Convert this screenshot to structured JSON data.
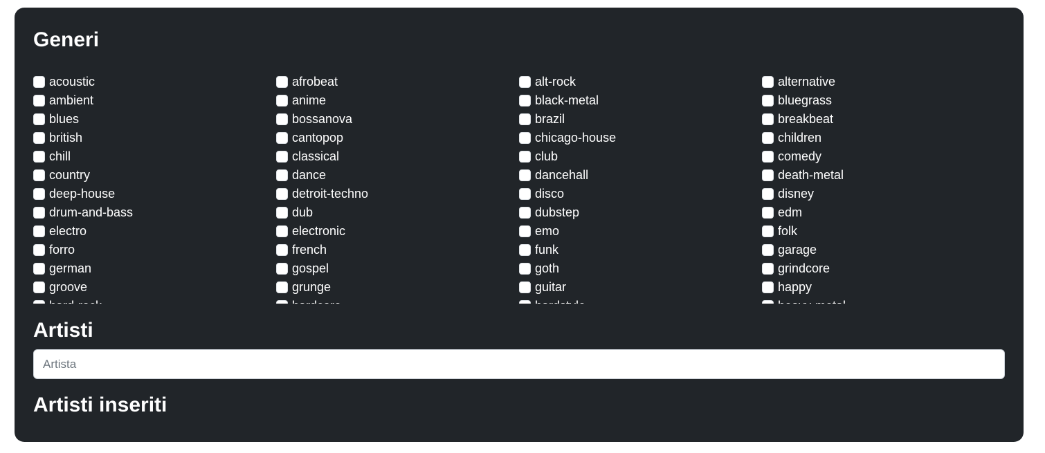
{
  "sections": {
    "genres_title": "Generi",
    "artists_title": "Artisti",
    "inserted_artists_title": "Artisti inseriti"
  },
  "artist_input": {
    "placeholder": "Artista",
    "value": ""
  },
  "genres": [
    {
      "label": "acoustic",
      "checked": false
    },
    {
      "label": "afrobeat",
      "checked": false
    },
    {
      "label": "alt-rock",
      "checked": false
    },
    {
      "label": "alternative",
      "checked": false
    },
    {
      "label": "ambient",
      "checked": false
    },
    {
      "label": "anime",
      "checked": false
    },
    {
      "label": "black-metal",
      "checked": false
    },
    {
      "label": "bluegrass",
      "checked": false
    },
    {
      "label": "blues",
      "checked": false
    },
    {
      "label": "bossanova",
      "checked": false
    },
    {
      "label": "brazil",
      "checked": false
    },
    {
      "label": "breakbeat",
      "checked": false
    },
    {
      "label": "british",
      "checked": false
    },
    {
      "label": "cantopop",
      "checked": false
    },
    {
      "label": "chicago-house",
      "checked": false
    },
    {
      "label": "children",
      "checked": false
    },
    {
      "label": "chill",
      "checked": false
    },
    {
      "label": "classical",
      "checked": false
    },
    {
      "label": "club",
      "checked": false
    },
    {
      "label": "comedy",
      "checked": false
    },
    {
      "label": "country",
      "checked": false
    },
    {
      "label": "dance",
      "checked": false
    },
    {
      "label": "dancehall",
      "checked": false
    },
    {
      "label": "death-metal",
      "checked": false
    },
    {
      "label": "deep-house",
      "checked": false
    },
    {
      "label": "detroit-techno",
      "checked": false
    },
    {
      "label": "disco",
      "checked": false
    },
    {
      "label": "disney",
      "checked": false
    },
    {
      "label": "drum-and-bass",
      "checked": false
    },
    {
      "label": "dub",
      "checked": false
    },
    {
      "label": "dubstep",
      "checked": false
    },
    {
      "label": "edm",
      "checked": false
    },
    {
      "label": "electro",
      "checked": false
    },
    {
      "label": "electronic",
      "checked": false
    },
    {
      "label": "emo",
      "checked": false
    },
    {
      "label": "folk",
      "checked": false
    },
    {
      "label": "forro",
      "checked": false
    },
    {
      "label": "french",
      "checked": false
    },
    {
      "label": "funk",
      "checked": false
    },
    {
      "label": "garage",
      "checked": false
    },
    {
      "label": "german",
      "checked": false
    },
    {
      "label": "gospel",
      "checked": false
    },
    {
      "label": "goth",
      "checked": false
    },
    {
      "label": "grindcore",
      "checked": false
    },
    {
      "label": "groove",
      "checked": false
    },
    {
      "label": "grunge",
      "checked": false
    },
    {
      "label": "guitar",
      "checked": false
    },
    {
      "label": "happy",
      "checked": false
    },
    {
      "label": "hard-rock",
      "checked": false
    },
    {
      "label": "hardcore",
      "checked": false
    },
    {
      "label": "hardstyle",
      "checked": false
    },
    {
      "label": "heavy-metal",
      "checked": false
    }
  ]
}
